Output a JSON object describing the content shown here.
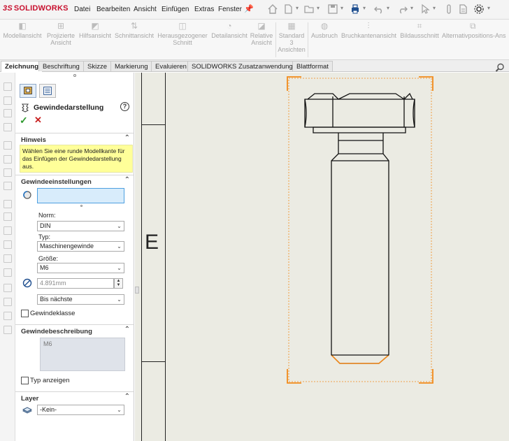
{
  "app": {
    "brand_prefix": "3S",
    "brand_name": "SOLIDWORKS",
    "accent": "#c8102e"
  },
  "menu": [
    "Datei",
    "Bearbeiten",
    "Ansicht",
    "Einfügen",
    "Extras",
    "Fenster"
  ],
  "ribbon": {
    "commands": [
      {
        "label": "Modellansicht"
      },
      {
        "label": "Projizierte Ansicht"
      },
      {
        "label": "Hilfsansicht"
      },
      {
        "label": "Schnittansicht"
      },
      {
        "label": "Herausgezogener Schnitt"
      },
      {
        "label": "Detailansicht"
      },
      {
        "label": "Relative Ansicht"
      },
      {
        "label": "Standard 3 Ansichten"
      },
      {
        "label": "Ausbruch"
      },
      {
        "label": "Bruchkantenansicht"
      },
      {
        "label": "Bildausschnitt"
      },
      {
        "label": "Alternativpositions-Ans"
      }
    ]
  },
  "tabs": [
    "Zeichnung",
    "Beschriftung",
    "Skizze",
    "Markierung",
    "Evaluieren",
    "SOLIDWORKS Zusatzanwendungen",
    "Blattformat"
  ],
  "active_tab": "Zeichnung",
  "pm": {
    "title": "Gewindedarstellung",
    "help_glyph": "?",
    "ok_glyph": "✓",
    "cancel_glyph": "✕",
    "hint": {
      "title": "Hinweis",
      "text": "Wählen Sie eine runde Modellkante für das Einfügen der Gewindedarstellung aus."
    },
    "settings": {
      "title": "Gewindeeinstellungen",
      "norm_label": "Norm:",
      "norm_value": "DIN",
      "type_label": "Typ:",
      "type_value": "Maschinengewinde",
      "size_label": "Größe:",
      "size_value": "M6",
      "diameter_value": "4.891mm",
      "end_condition": "Bis nächste",
      "thread_class_label": "Gewindeklasse"
    },
    "description": {
      "title": "Gewindebeschreibung",
      "value": "M6",
      "show_type_label": "Typ anzeigen"
    },
    "layer": {
      "title": "Layer",
      "value": "-Kein-"
    }
  },
  "sheet": {
    "zone_letter": "E",
    "selection_color": "#f28a1a"
  }
}
